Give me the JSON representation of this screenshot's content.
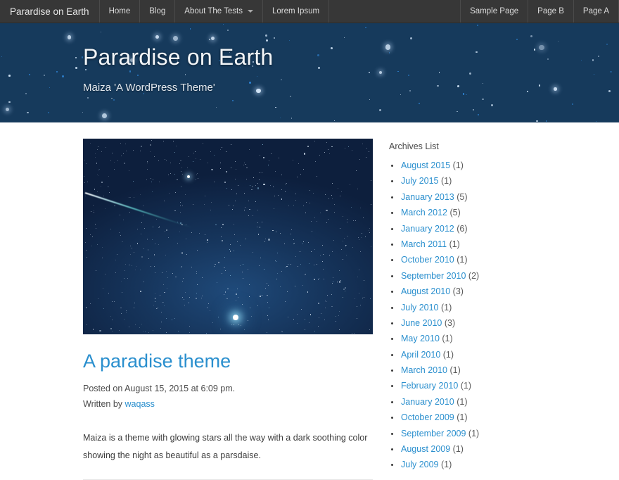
{
  "navbar": {
    "brand": "Parardise on Earth",
    "left_items": [
      {
        "label": "Home",
        "icon": null
      },
      {
        "label": "Blog",
        "icon": null
      },
      {
        "label": "About The Tests",
        "icon": "chevron-down-icon"
      },
      {
        "label": "Lorem Ipsum",
        "icon": null
      }
    ],
    "right_items": [
      {
        "label": "Sample Page"
      },
      {
        "label": "Page B"
      },
      {
        "label": "Page A"
      }
    ],
    "background_color": "#373737",
    "text_color": "#dcdcdc"
  },
  "site_header": {
    "title": "Parardise on Earth",
    "tagline": "Maiza 'A WordPress Theme'",
    "background_color": "#163a5c",
    "title_color": "#f2f5f8"
  },
  "post": {
    "featured_image_alt": "night-sky-starfield-with-meteor",
    "title": "A paradise theme",
    "posted_on": "Posted on August 15, 2015 at 6:09 pm.",
    "written_by_prefix": "Written by ",
    "author": "waqass",
    "excerpt": "Maiza is a theme with glowing stars all the way with a dark soothing color showing the night as beautiful as a parsdaise.",
    "title_color": "#2a8fce"
  },
  "sidebar": {
    "archives_heading": "Archives List",
    "link_color": "#2a8fce",
    "archives": [
      {
        "label": "August 2015",
        "count": "(1)"
      },
      {
        "label": "July 2015",
        "count": "(1)"
      },
      {
        "label": "January 2013",
        "count": "(5)"
      },
      {
        "label": "March 2012",
        "count": "(5)"
      },
      {
        "label": "January 2012",
        "count": "(6)"
      },
      {
        "label": "March 2011",
        "count": "(1)"
      },
      {
        "label": "October 2010",
        "count": "(1)"
      },
      {
        "label": "September 2010",
        "count": "(2)"
      },
      {
        "label": "August 2010",
        "count": "(3)"
      },
      {
        "label": "July 2010",
        "count": "(1)"
      },
      {
        "label": "June 2010",
        "count": "(3)"
      },
      {
        "label": "May 2010",
        "count": "(1)"
      },
      {
        "label": "April 2010",
        "count": "(1)"
      },
      {
        "label": "March 2010",
        "count": "(1)"
      },
      {
        "label": "February 2010",
        "count": "(1)"
      },
      {
        "label": "January 2010",
        "count": "(1)"
      },
      {
        "label": "October 2009",
        "count": "(1)"
      },
      {
        "label": "September 2009",
        "count": "(1)"
      },
      {
        "label": "August 2009",
        "count": "(1)"
      },
      {
        "label": "July 2009",
        "count": "(1)"
      }
    ]
  }
}
